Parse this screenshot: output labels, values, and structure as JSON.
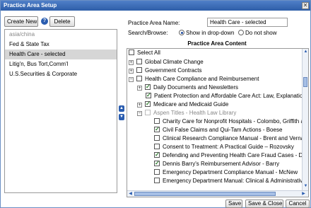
{
  "window": {
    "title": "Practice Area Setup"
  },
  "toolbar": {
    "create_new": "Create New",
    "delete": "Delete"
  },
  "left_list": {
    "items": [
      {
        "label": "asia/china",
        "dim": true,
        "selected": false
      },
      {
        "label": "Fed & State Tax",
        "dim": false,
        "selected": false
      },
      {
        "label": "Health Care - selected",
        "dim": false,
        "selected": true
      },
      {
        "label": "Litig'n, Bus Tort,Comm'l",
        "dim": false,
        "selected": false
      },
      {
        "label": "U.S.Securities & Corporate",
        "dim": false,
        "selected": false
      }
    ]
  },
  "form": {
    "name_label": "Practice Area Name:",
    "name_value": "Health Care - selected",
    "search_label": "Search/Browse:",
    "radio_show": "Show in drop-down",
    "radio_hide": "Do not show",
    "radio_selected": "show"
  },
  "content": {
    "header": "Practice Area Content",
    "select_all": "Select All",
    "rows": [
      {
        "label": "Global Climate Change",
        "expander": "+",
        "checked": false,
        "disabled": false
      },
      {
        "label": "Government Contracts",
        "expander": "+",
        "checked": false,
        "disabled": false
      },
      {
        "label": "Health Care Compliance and Reimbursement",
        "expander": "−",
        "checked": false,
        "disabled": false
      },
      {
        "label": "Daily Documents and Newsletters",
        "expander": "+",
        "checked": true,
        "disabled": false
      },
      {
        "label": "Patient Protection and Affordable Care Act: Law, Explanation,",
        "expander": "",
        "checked": true,
        "disabled": false
      },
      {
        "label": "Medicare and Medicaid Guide",
        "expander": "+",
        "checked": true,
        "disabled": false
      },
      {
        "label": "Aspen Titles - Health Law Library",
        "expander": "−",
        "checked": false,
        "disabled": true
      },
      {
        "label": "Charity Care for Nonprofit Hospitals - Colombo, Griffith an",
        "expander": "",
        "checked": false,
        "disabled": false
      },
      {
        "label": "Civil False Claims and Qui-Tam Actions - Boese",
        "expander": "",
        "checked": true,
        "disabled": false
      },
      {
        "label": "Clinical Research Compliance Manual - Brent and Vernag",
        "expander": "",
        "checked": false,
        "disabled": false
      },
      {
        "label": "Consent to Treatment: A Practical Guide – Rozovsky",
        "expander": "",
        "checked": false,
        "disabled": false
      },
      {
        "label": "Defending and Preventing Health Care Fraud Cases - Da",
        "expander": "",
        "checked": true,
        "disabled": false
      },
      {
        "label": "Dennis Barry's Reimbursement Advisor - Barry",
        "expander": "",
        "checked": true,
        "disabled": false
      },
      {
        "label": "Emergency Department Compliance Manual - McNew",
        "expander": "",
        "checked": false,
        "disabled": false
      },
      {
        "label": "Emergency Department Manual: Clinical & Administrative",
        "expander": "",
        "checked": false,
        "disabled": false
      }
    ]
  },
  "footer": {
    "save": "Save",
    "save_close": "Save & Close",
    "cancel": "Cancel"
  }
}
